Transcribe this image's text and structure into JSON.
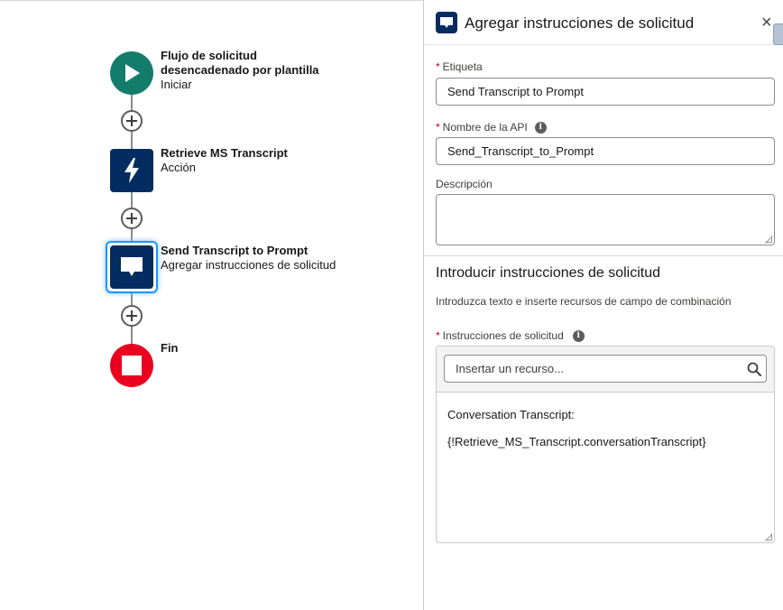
{
  "flow": {
    "nodes": [
      {
        "title_line1": "Flujo de solicitud",
        "title_line2": "desencadenado por plantilla",
        "subtitle": "Iniciar",
        "icon": "play-icon",
        "color": "#147c6c"
      },
      {
        "title": "Retrieve MS Transcript",
        "subtitle": "Acción",
        "icon": "lightning-icon",
        "color": "#032d60"
      },
      {
        "title": "Send Transcript to Prompt",
        "subtitle": "Agregar instrucciones de solicitud",
        "icon": "chat-icon",
        "color": "#032d60"
      },
      {
        "title": "Fin",
        "icon": "stop-icon",
        "color": "#ea001e"
      }
    ],
    "add_icon": "plus-icon"
  },
  "panel": {
    "title": "Agregar instrucciones de solicitud",
    "header_icon": "chat-icon",
    "close_symbol": "×",
    "fields": {
      "label": {
        "label": "Etiqueta",
        "required": "*",
        "value": "Send Transcript to Prompt"
      },
      "api_name": {
        "label": "Nombre de la API",
        "required": "*",
        "value": "Send_Transcript_to_Prompt",
        "info": "i"
      },
      "description": {
        "label": "Descripción",
        "value": ""
      }
    },
    "section": {
      "title": "Introducir instrucciones de solicitud",
      "description": "Introduzca texto e inserte recursos de campo de combinación"
    },
    "instructions": {
      "label": "Instrucciones de solicitud",
      "required": "*",
      "info": "i",
      "search_placeholder": "Insertar un recurso...",
      "content_line1": "Conversation Transcript:",
      "content_line2": "{!Retrieve_MS_Transcript.conversationTranscript}"
    }
  },
  "colors": {
    "start": "#147c6c",
    "action": "#032d60",
    "end": "#ea001e",
    "required": "#ba0517",
    "selection": "#1b96ff"
  }
}
